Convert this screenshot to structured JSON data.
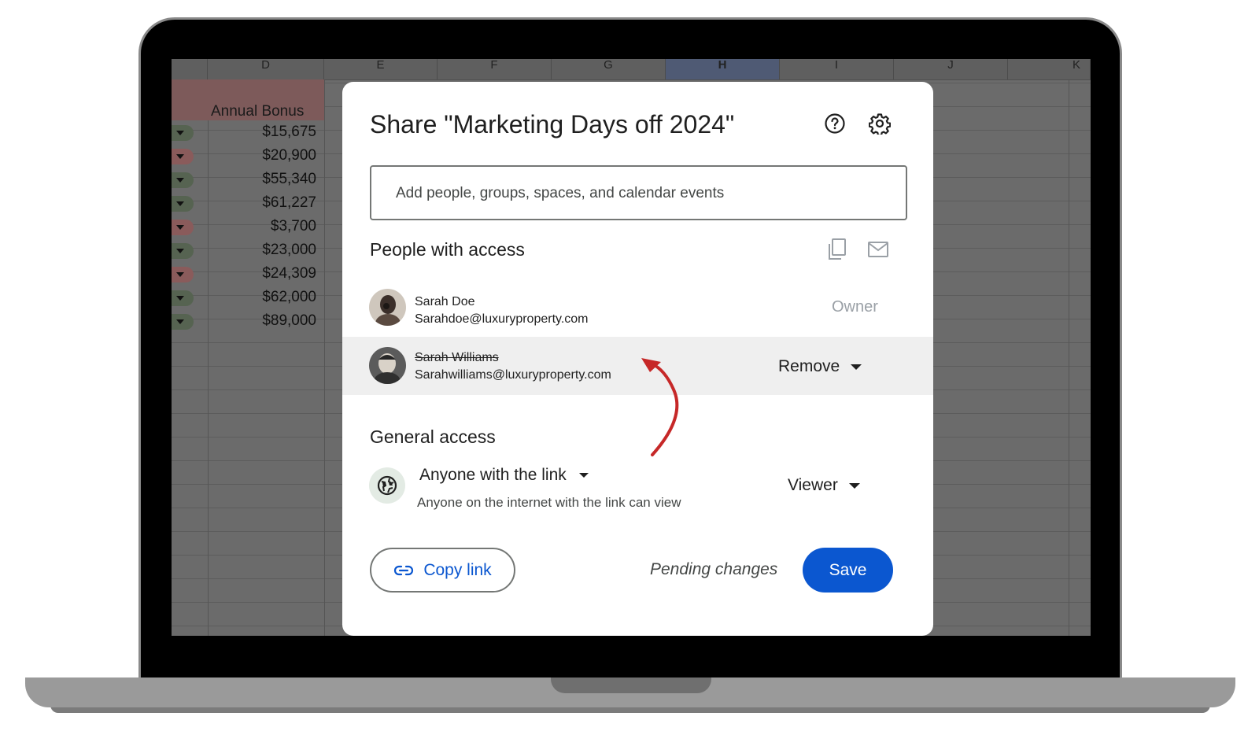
{
  "spreadsheet": {
    "columns": [
      "D",
      "E",
      "F",
      "G",
      "H",
      "I",
      "J",
      "K"
    ],
    "active_column": "H",
    "bonus_header": "Annual Bonus",
    "bonus_values": [
      "$15,675",
      "$20,900",
      "$55,340",
      "$61,227",
      "$3,700",
      "$23,000",
      "$24,309",
      "$62,000",
      "$89,000"
    ],
    "bonus_status": [
      "green",
      "red",
      "green",
      "green",
      "red",
      "green",
      "red",
      "green",
      "green"
    ]
  },
  "dialog": {
    "title": "Share \"Marketing Days off 2024\"",
    "help_icon": "help-circle-icon",
    "settings_icon": "gear-icon",
    "search_placeholder": "Add people, groups, spaces, and calendar events",
    "people_section_title": "People with access",
    "people": [
      {
        "name": "Sarah Doe",
        "email": "Sarahdoe@luxuryproperty.com",
        "role": "Owner"
      },
      {
        "name": "Sarah Williams",
        "email": "Sarahwilliams@luxuryproperty.com",
        "role": "Remove"
      }
    ],
    "general_access_title": "General access",
    "link_access": "Anyone with the link",
    "link_access_desc": "Anyone on the internet with the link can view",
    "link_role": "Viewer",
    "copy_link_label": "Copy link",
    "pending_label": "Pending changes",
    "save_label": "Save",
    "accent_color": "#0b57d0",
    "annotation_arrow_color": "#c62828"
  }
}
